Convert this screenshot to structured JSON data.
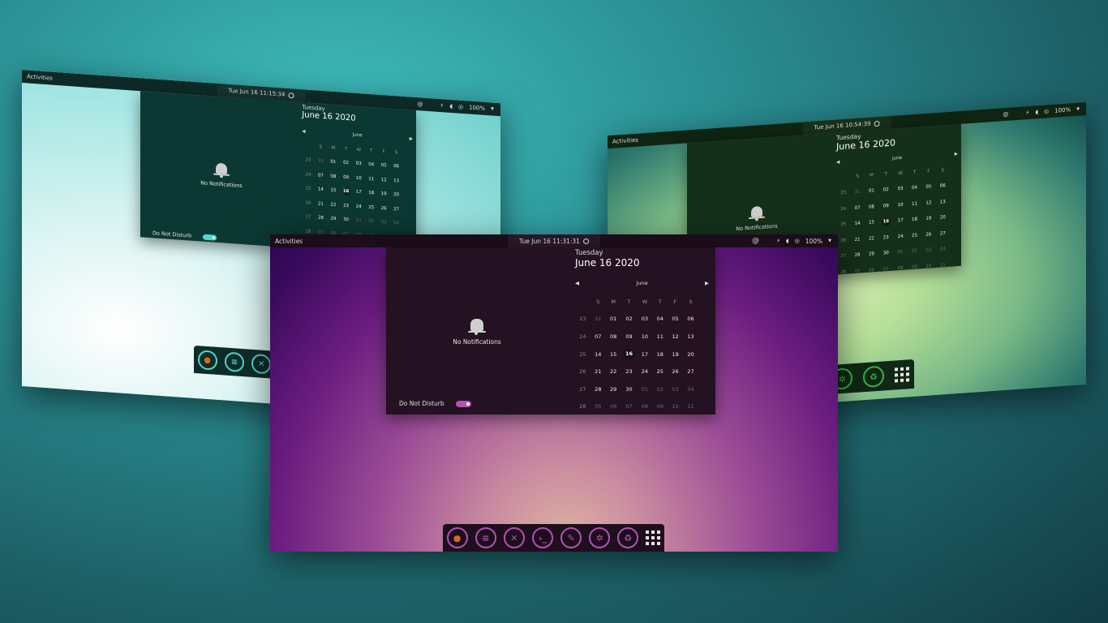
{
  "front": {
    "topbar": {
      "activities": "Activities",
      "clock": "Tue Jun 16  11:31:31",
      "at": "@",
      "battery": "100%"
    },
    "notifications": {
      "empty_text": "No Notifications",
      "dnd_label": "Do Not Disturb",
      "dnd_on": true
    },
    "calendar": {
      "weekday": "Tuesday",
      "date": "June 16 2020",
      "month": "June",
      "headers": [
        "S",
        "M",
        "T",
        "W",
        "T",
        "F",
        "S"
      ],
      "weeks": [
        {
          "wk": "23",
          "days": [
            "31",
            "01",
            "02",
            "03",
            "04",
            "05",
            "06"
          ]
        },
        {
          "wk": "24",
          "days": [
            "07",
            "08",
            "09",
            "10",
            "11",
            "12",
            "13"
          ]
        },
        {
          "wk": "25",
          "days": [
            "14",
            "15",
            "16",
            "17",
            "18",
            "19",
            "20"
          ]
        },
        {
          "wk": "26",
          "days": [
            "21",
            "22",
            "23",
            "24",
            "25",
            "26",
            "27"
          ]
        },
        {
          "wk": "27",
          "days": [
            "28",
            "29",
            "30",
            "01",
            "02",
            "03",
            "04"
          ]
        },
        {
          "wk": "28",
          "days": [
            "05",
            "06",
            "07",
            "08",
            "09",
            "10",
            "11"
          ]
        }
      ]
    },
    "dock": [
      "firefox-icon",
      "files-icon",
      "settings-tools-icon",
      "terminal-icon",
      "text-editor-icon",
      "screenshot-icon",
      "recycle-icon",
      "app-grid-icon"
    ]
  },
  "left": {
    "topbar": {
      "activities": "Activities",
      "clock": "Tue Jun 16  11:15:34",
      "at": "@",
      "battery": "100%"
    },
    "notifications": {
      "empty_text": "No Notifications",
      "dnd_label": "Do Not Disturb"
    },
    "calendar": {
      "weekday": "Tuesday",
      "date": "June 16 2020",
      "month": "June",
      "headers": [
        "S",
        "M",
        "T",
        "W",
        "T",
        "F",
        "S"
      ],
      "weeks": [
        {
          "wk": "23",
          "days": [
            "31",
            "01",
            "02",
            "03",
            "04",
            "05",
            "06"
          ]
        },
        {
          "wk": "24",
          "days": [
            "07",
            "08",
            "09",
            "10",
            "11",
            "12",
            "13"
          ]
        },
        {
          "wk": "25",
          "days": [
            "14",
            "15",
            "16",
            "17",
            "18",
            "19",
            "20"
          ]
        },
        {
          "wk": "26",
          "days": [
            "21",
            "22",
            "23",
            "24",
            "25",
            "26",
            "27"
          ]
        },
        {
          "wk": "27",
          "days": [
            "28",
            "29",
            "30",
            "01",
            "02",
            "03",
            "04"
          ]
        },
        {
          "wk": "28",
          "days": [
            "05",
            "06",
            "07",
            "08",
            "09",
            "10",
            "11"
          ]
        }
      ]
    },
    "dock": [
      "firefox-icon",
      "files-icon",
      "settings-tools-icon"
    ]
  },
  "right": {
    "topbar": {
      "activities": "Activities",
      "clock": "Tue Jun 16  10:54:39",
      "at": "@",
      "battery": "100%"
    },
    "notifications": {
      "empty_text": "No Notifications"
    },
    "calendar": {
      "weekday": "Tuesday",
      "date": "June 16 2020",
      "month": "June",
      "headers": [
        "S",
        "M",
        "T",
        "W",
        "T",
        "F",
        "S"
      ],
      "weeks": [
        {
          "wk": "23",
          "days": [
            "31",
            "01",
            "02",
            "03",
            "04",
            "05",
            "06"
          ]
        },
        {
          "wk": "24",
          "days": [
            "07",
            "08",
            "09",
            "10",
            "11",
            "12",
            "13"
          ]
        },
        {
          "wk": "25",
          "days": [
            "14",
            "15",
            "16",
            "17",
            "18",
            "19",
            "20"
          ]
        },
        {
          "wk": "26",
          "days": [
            "21",
            "22",
            "23",
            "24",
            "25",
            "26",
            "27"
          ]
        },
        {
          "wk": "27",
          "days": [
            "28",
            "29",
            "30",
            "01",
            "02",
            "03",
            "04"
          ]
        },
        {
          "wk": "28",
          "days": [
            "05",
            "06",
            "07",
            "08",
            "09",
            "10",
            "11"
          ]
        }
      ]
    },
    "dock": [
      "screenshot-icon",
      "recycle-icon",
      "app-grid-icon"
    ]
  },
  "colors": {
    "front_panel": "#241122",
    "front_bar": "#1c0d1a",
    "front_accent": "#b053b0",
    "left_panel": "#0c3833",
    "left_bar": "#0d2a27",
    "left_accent": "#4fd7d0",
    "right_panel": "#15301a",
    "right_bar": "#0f2412",
    "right_accent": "#36b83a"
  }
}
